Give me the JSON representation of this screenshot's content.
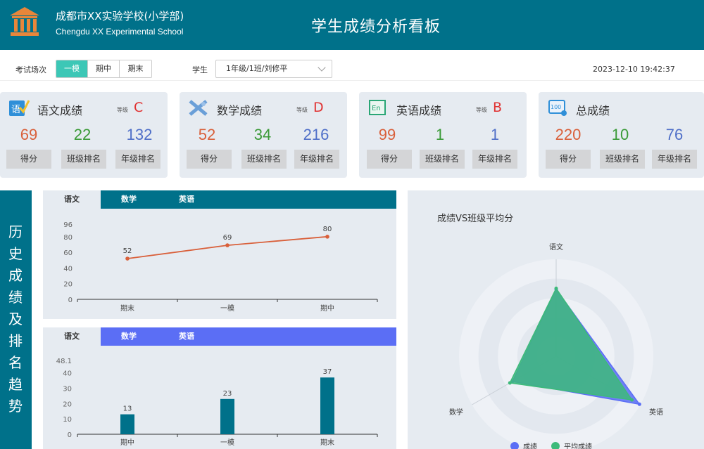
{
  "header": {
    "school_cn": "成都市XX实验学校(小学部)",
    "school_en": "Chengdu XX Experimental School",
    "title": "学生成绩分析看板",
    "bg_color": "#00718a"
  },
  "filters": {
    "exam_label": "考试场次",
    "exam_options": [
      "一模",
      "期中",
      "期末"
    ],
    "exam_selected": "一模",
    "student_label": "学生",
    "student_value": "1年级/1班/刘修平",
    "datetime": "2023-12-10 19:42:37"
  },
  "cards": [
    {
      "title": "语文成绩",
      "icon": "chinese-icon",
      "grade_label": "等级",
      "grade": "C",
      "score": "69",
      "class_rank": "22",
      "grade_rank": "132",
      "btn_score": "得分",
      "btn_class": "班级排名",
      "btn_grade": "年级排名"
    },
    {
      "title": "数学成绩",
      "icon": "math-icon",
      "grade_label": "等级",
      "grade": "D",
      "score": "52",
      "class_rank": "34",
      "grade_rank": "216",
      "btn_score": "得分",
      "btn_class": "班级排名",
      "btn_grade": "年级排名"
    },
    {
      "title": "英语成绩",
      "icon": "english-icon",
      "grade_label": "等级",
      "grade": "B",
      "score": "99",
      "class_rank": "1",
      "grade_rank": "1",
      "btn_score": "得分",
      "btn_class": "班级排名",
      "btn_grade": "年级排名"
    },
    {
      "title": "总成绩",
      "icon": "total-icon",
      "score": "220",
      "class_rank": "10",
      "grade_rank": "76",
      "btn_score": "得分",
      "btn_class": "班级排名",
      "btn_grade": "年级排名"
    }
  ],
  "trend_banner": "历史成绩及排名趋势",
  "score_panel": {
    "tabs": [
      "语文",
      "数学",
      "英语"
    ],
    "tab_bar_color": "#00718a"
  },
  "rank_panel": {
    "tabs": [
      "语文",
      "数学",
      "英语"
    ],
    "tab_bar_color": "#5b6ef5"
  },
  "chart_data": [
    {
      "type": "line",
      "categories": [
        "期末",
        "一模",
        "期中"
      ],
      "values": [
        52,
        69,
        80
      ],
      "ylim": [
        0,
        96
      ],
      "yticks": [
        0,
        20,
        40,
        60,
        80,
        96
      ],
      "color": "#d9603b"
    },
    {
      "type": "bar",
      "categories": [
        "期中",
        "一模",
        "期末"
      ],
      "values": [
        13,
        23,
        37
      ],
      "ylim": [
        0,
        48.1
      ],
      "yticks": [
        "0",
        "10",
        "20",
        "30",
        "40",
        "48.1"
      ],
      "color": "#00718a"
    },
    {
      "type": "radar",
      "title": "成绩VS班级平均分",
      "indicators": [
        "语文",
        "英语",
        "数学"
      ],
      "series": [
        {
          "name": "成绩",
          "values": [
            69,
            99,
            52
          ],
          "color": "#5b6ef5"
        },
        {
          "name": "平均成绩",
          "values": [
            70,
            90,
            55
          ],
          "color": "#3dba7a"
        }
      ],
      "max": 100
    }
  ]
}
